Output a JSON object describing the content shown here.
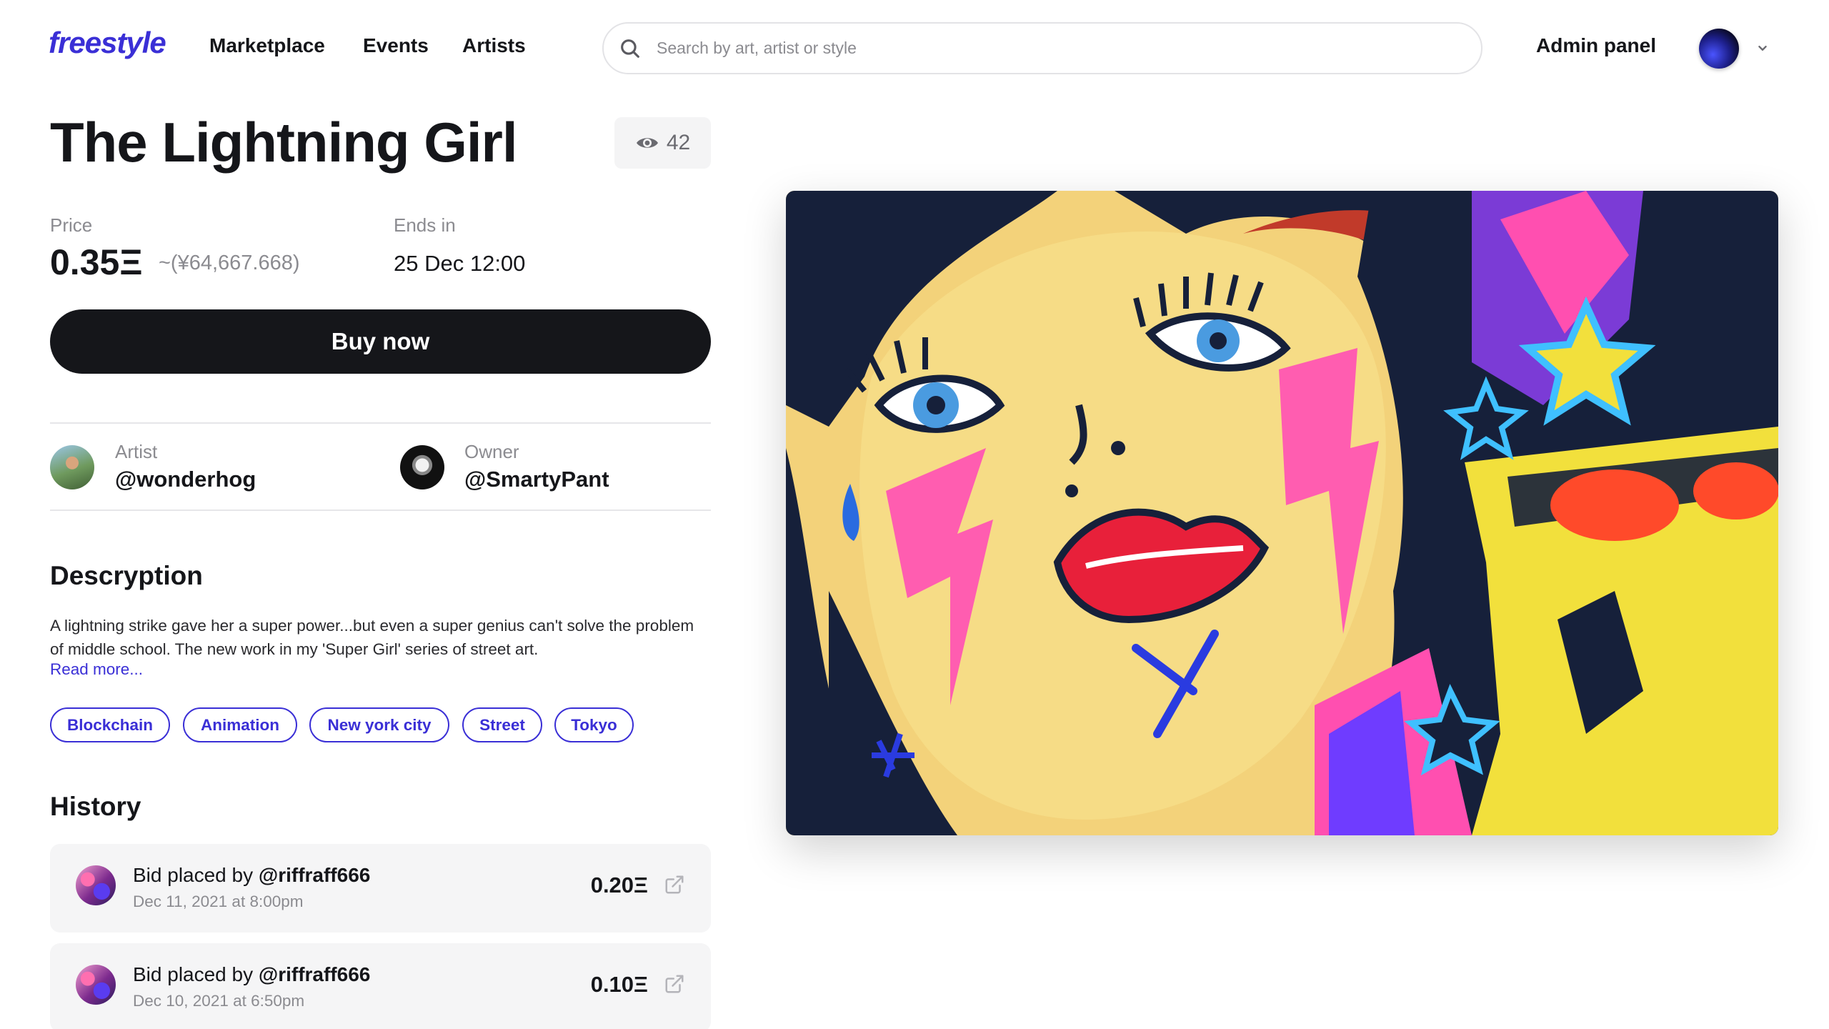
{
  "header": {
    "logo": "freestyle",
    "nav": [
      "Marketplace",
      "Events",
      "Artists"
    ],
    "search_placeholder": "Search by art, artist or style",
    "admin_label": "Admin panel"
  },
  "artwork": {
    "title": "The Lightning Girl",
    "views": "42",
    "price_label": "Price",
    "price": "0.35Ξ",
    "price_fiat": "~(¥64,667.668)",
    "ends_label": "Ends in",
    "ends_value": "25 Dec 12:00",
    "buy_label": "Buy now"
  },
  "people": {
    "artist_label": "Artist",
    "artist_handle": "@wonderhog",
    "owner_label": "Owner",
    "owner_handle": "@SmartyPant"
  },
  "description": {
    "heading": "Descryption",
    "text": "A lightning strike gave her a super power...but even a super genius can't solve the problem of middle school. The new work in my 'Super Girl' series of street art.",
    "read_more": "Read more..."
  },
  "tags": [
    "Blockchain",
    "Animation",
    "New york city",
    "Street",
    "Tokyo"
  ],
  "history": {
    "heading": "History",
    "items": [
      {
        "prefix": "Bid placed by ",
        "user": "@riffraff666",
        "date": "Dec 11, 2021 at 8:00pm",
        "amount": "0.20Ξ"
      },
      {
        "prefix": "Bid placed by ",
        "user": "@riffraff666",
        "date": "Dec 10, 2021 at 6:50pm",
        "amount": "0.10Ξ"
      }
    ]
  },
  "colors": {
    "accent": "#3a2fd6",
    "dark": "#15161a",
    "muted": "#8b8b90"
  }
}
